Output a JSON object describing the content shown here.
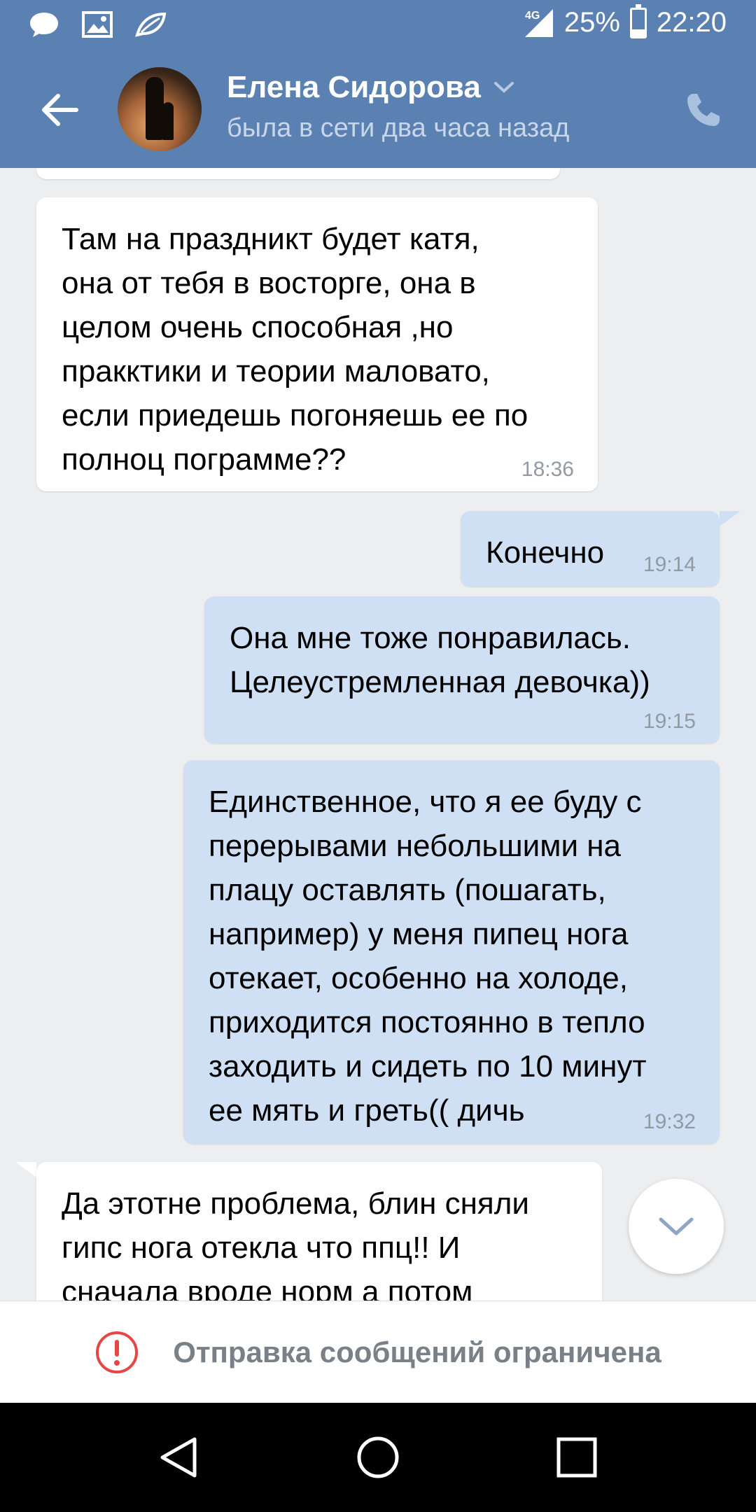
{
  "status_bar": {
    "network": "4G",
    "battery_percent_text": "25%",
    "battery_level": 0.25,
    "time": "22:20",
    "icons": [
      "chat-icon",
      "image-icon",
      "leaf-icon"
    ]
  },
  "header": {
    "contact_name": "Елена Сидорова",
    "contact_status": "была в сети два часа назад"
  },
  "messages": [
    {
      "direction": "in",
      "text": "Там на праздникт будет катя,\nона от тебя в восторге, она в\nцелом очень способная ,но\nпракктики и теории маловато,\nесли приедешь погоняешь ее по\nполноц пограмме??",
      "time": "18:36"
    },
    {
      "direction": "out",
      "text": "Конечно",
      "time": "19:14"
    },
    {
      "direction": "out",
      "text": "Она мне тоже понравилась.\nЦелеустремленная девочка))",
      "time": "19:15"
    },
    {
      "direction": "out",
      "text": "Единственное, что я ее буду с\nперерывами небольшими на\nплацу оставлять (пошагать,\nнапример) у меня пипец нога\nотекает, особенно на холоде,\nприходится постоянно в тепло\nзаходить и сидеть по 10 минут\nее мять и греть(( дичь",
      "time": "19:32"
    },
    {
      "direction": "in",
      "text": "Да этотне проблема, блин сняли\nгипс нога отекла что ппц!! И\nсначала вроде норм а потом",
      "time": ""
    }
  ],
  "restriction": {
    "text": "Отправка сообщений ограничена"
  },
  "colors": {
    "header_blue": "#5b80b2",
    "incoming_bubble": "#ffffff",
    "outgoing_bubble": "#cfe0f5",
    "background": "#edeef0",
    "warning_red": "#e64646"
  }
}
